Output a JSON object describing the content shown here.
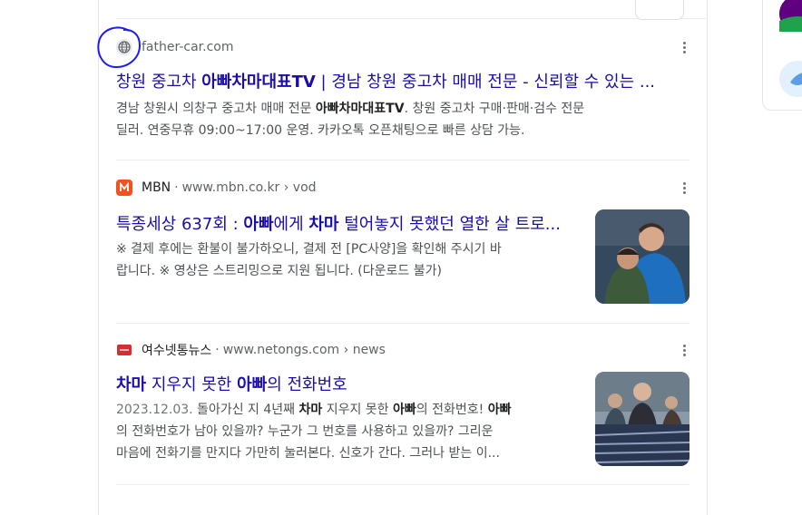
{
  "results": [
    {
      "source_name": "",
      "url": "father-car.com",
      "title_parts": [
        "창원 중고차 ",
        "아빠차마대표TV",
        " | 경남 창원 중고차 매매 전문 - 신뢰할 수 있는 ..."
      ],
      "snippet_line1_parts": [
        "경남 창원시 의창구 중고차 매매 전문 ",
        "아빠차마대표TV",
        ". 창원 중고차 구매·판매·검수 전문"
      ],
      "snippet_line2": "딜러. 연중무휴 09:00~17:00 운영. 카카오톡 오픈채팅으로 빠른 상담 가능.",
      "favicon_icon": "globe-icon"
    },
    {
      "source_name": "MBN",
      "url": "www.mbn.co.kr › vod",
      "title_parts": [
        "특종세상 637회 : ",
        "아빠",
        "에게 ",
        "차마",
        " 털어놓지 못했던 열한 살 트로..."
      ],
      "snippet_line1": "※ 결제 후에는 환불이 불가하오니, 결제 전 [PC사양]을 확인해 주시기 바",
      "snippet_line2": "랍니다. ※ 영상은 스트리밍으로 지원 됩니다. (다운로드 불가)",
      "favicon_icon": "mbn-logo-icon",
      "favicon_color": "#f4511e"
    },
    {
      "source_name": "여수넷통뉴스",
      "url": "www.netongs.com › news",
      "title_parts": [
        "차마",
        " 지우지 못한 ",
        "아빠",
        "의 전화번호"
      ],
      "date": "2023.12.03.",
      "snippet_line1_parts": [
        " 돌아가신 지 4년째 ",
        "차마",
        " 지우지 못한 ",
        "아빠",
        "의 전화번호! ",
        "아빠"
      ],
      "snippet_line2": "의 전화번호가 남아 있을까? 누군가 그 번호를 사용하고 있을까? 그리운",
      "snippet_line3": "마음에 전화기를 만지다 가만히 눌러본다. 신호가 간다. 그러나 받는 이...",
      "favicon_icon": "netongs-logo-icon",
      "favicon_color": "#d32f2f"
    }
  ],
  "colors": {
    "link": "#1a0dab",
    "snippet": "#4d5156",
    "url": "#5f6368",
    "annotation_circle": "#1a1aff"
  }
}
